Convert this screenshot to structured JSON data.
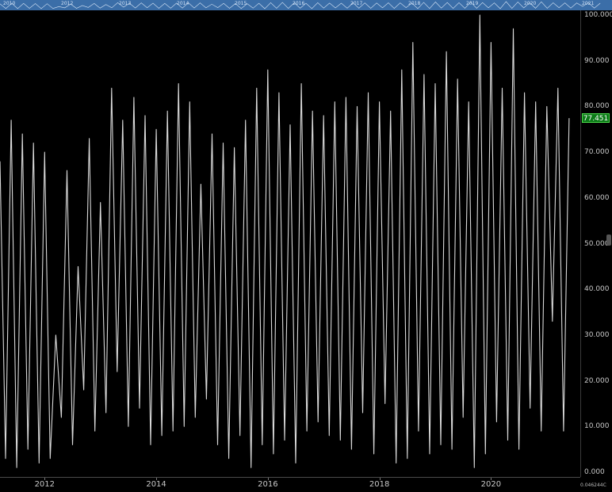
{
  "navigator": {
    "labels": [
      "2010",
      "2012",
      "2013",
      "2014",
      "2015",
      "2016",
      "2017",
      "2018",
      "2019",
      "2020",
      "2021"
    ]
  },
  "last_value_label": "77.451",
  "corner_info": "0.046244C",
  "chart_data": {
    "type": "line",
    "title": "",
    "xlabel": "",
    "ylabel": "",
    "x_ticks": [
      "2012",
      "2014",
      "2016",
      "2018",
      "2020"
    ],
    "y_ticks": [
      "0.000",
      "10.000",
      "20.000",
      "30.000",
      "40.000",
      "50.000",
      "60.000",
      "70.000",
      "80.000",
      "90.000",
      "100.000"
    ],
    "xlim": [
      2011.2,
      2021.6
    ],
    "ylim": [
      0,
      100
    ],
    "grid": false,
    "legend": "none",
    "last_value": 77.451,
    "line_color": "#d9d9d9",
    "series": [
      {
        "x": [
          2011.2,
          2011.3,
          2011.4,
          2011.5,
          2011.6,
          2011.7,
          2011.8,
          2011.9,
          2012.0,
          2012.1,
          2012.2,
          2012.3,
          2012.4,
          2012.5,
          2012.6,
          2012.7,
          2012.8,
          2012.9,
          2013.0,
          2013.1,
          2013.2,
          2013.3,
          2013.4,
          2013.5,
          2013.6,
          2013.7,
          2013.8,
          2013.9,
          2014.0,
          2014.1,
          2014.2,
          2014.3,
          2014.4,
          2014.5,
          2014.6,
          2014.7,
          2014.8,
          2014.9,
          2015.0,
          2015.1,
          2015.2,
          2015.3,
          2015.4,
          2015.5,
          2015.6,
          2015.7,
          2015.8,
          2015.9,
          2016.0,
          2016.1,
          2016.2,
          2016.3,
          2016.4,
          2016.5,
          2016.6,
          2016.7,
          2016.8,
          2016.9,
          2017.0,
          2017.1,
          2017.2,
          2017.3,
          2017.4,
          2017.5,
          2017.6,
          2017.7,
          2017.8,
          2017.9,
          2018.0,
          2018.1,
          2018.2,
          2018.3,
          2018.4,
          2018.5,
          2018.6,
          2018.7,
          2018.8,
          2018.9,
          2019.0,
          2019.1,
          2019.2,
          2019.3,
          2019.4,
          2019.5,
          2019.6,
          2019.7,
          2019.8,
          2019.9,
          2020.0,
          2020.1,
          2020.2,
          2020.3,
          2020.4,
          2020.5,
          2020.6,
          2020.7,
          2020.8,
          2020.9,
          2021.0,
          2021.1,
          2021.2,
          2021.3,
          2021.4
        ],
        "values": [
          68,
          3,
          77,
          1,
          74,
          5,
          72,
          2,
          70,
          3,
          30,
          12,
          66,
          6,
          45,
          18,
          73,
          9,
          59,
          13,
          84,
          22,
          77,
          10,
          82,
          14,
          78,
          6,
          75,
          8,
          79,
          9,
          85,
          10,
          81,
          12,
          63,
          16,
          74,
          6,
          72,
          3,
          71,
          8,
          77,
          1,
          84,
          6,
          88,
          4,
          83,
          7,
          76,
          2,
          85,
          9,
          79,
          11,
          78,
          8,
          81,
          7,
          82,
          5,
          80,
          13,
          83,
          4,
          81,
          15,
          79,
          2,
          88,
          3,
          94,
          9,
          87,
          4,
          85,
          6,
          92,
          5,
          86,
          12,
          81,
          1,
          100,
          4,
          94,
          11,
          84,
          7,
          97,
          5,
          83,
          14,
          81,
          9,
          80,
          33,
          84,
          9,
          77.451
        ]
      }
    ]
  }
}
